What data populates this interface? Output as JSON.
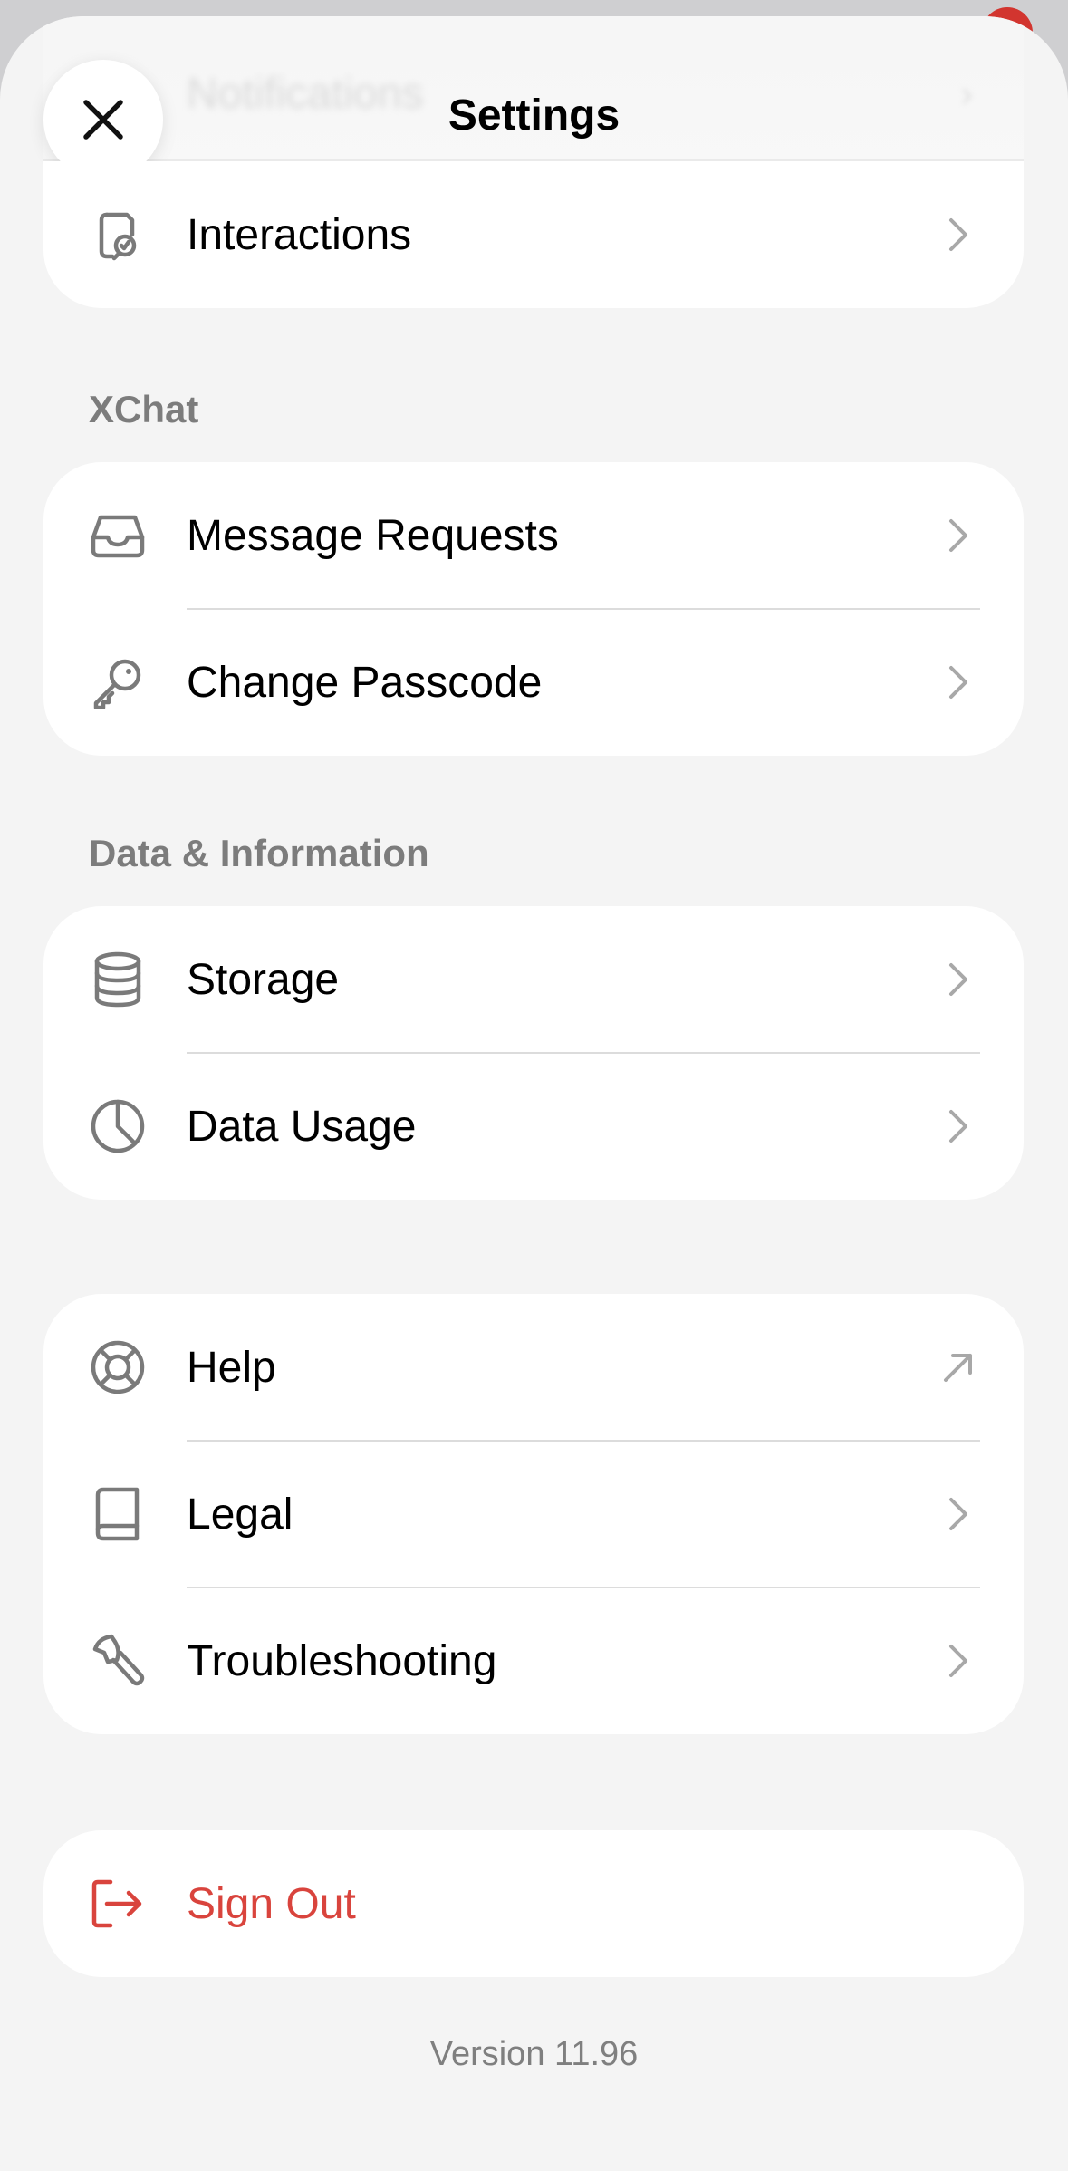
{
  "header": {
    "title": "Settings",
    "background_row_label": "Notifications"
  },
  "sections": {
    "top": {
      "items": [
        {
          "label": "Interactions",
          "icon": "interactions-icon",
          "trailing": "chevron-right-icon"
        }
      ]
    },
    "xchat": {
      "title": "XChat",
      "items": [
        {
          "label": "Message Requests",
          "icon": "inbox-icon",
          "trailing": "chevron-right-icon"
        },
        {
          "label": "Change Passcode",
          "icon": "key-icon",
          "trailing": "chevron-right-icon"
        }
      ]
    },
    "data_information": {
      "title": "Data & Information",
      "items": [
        {
          "label": "Storage",
          "icon": "database-icon",
          "trailing": "chevron-right-icon"
        },
        {
          "label": "Data Usage",
          "icon": "pie-clock-icon",
          "trailing": "chevron-right-icon"
        }
      ]
    },
    "support": {
      "items": [
        {
          "label": "Help",
          "icon": "lifebuoy-icon",
          "trailing": "external-arrow-icon"
        },
        {
          "label": "Legal",
          "icon": "book-icon",
          "trailing": "chevron-right-icon"
        },
        {
          "label": "Troubleshooting",
          "icon": "wrench-icon",
          "trailing": "chevron-right-icon"
        }
      ]
    },
    "account": {
      "items": [
        {
          "label": "Sign Out",
          "icon": "sign-out-icon"
        }
      ]
    }
  },
  "footer": {
    "version": "Version 11.96"
  },
  "colors": {
    "background": "#f4f4f4",
    "card": "#ffffff",
    "section_header": "#7c7c7c",
    "icon_gray": "#7a7a7a",
    "destructive": "#d9443d",
    "badge": "#d2352f"
  }
}
